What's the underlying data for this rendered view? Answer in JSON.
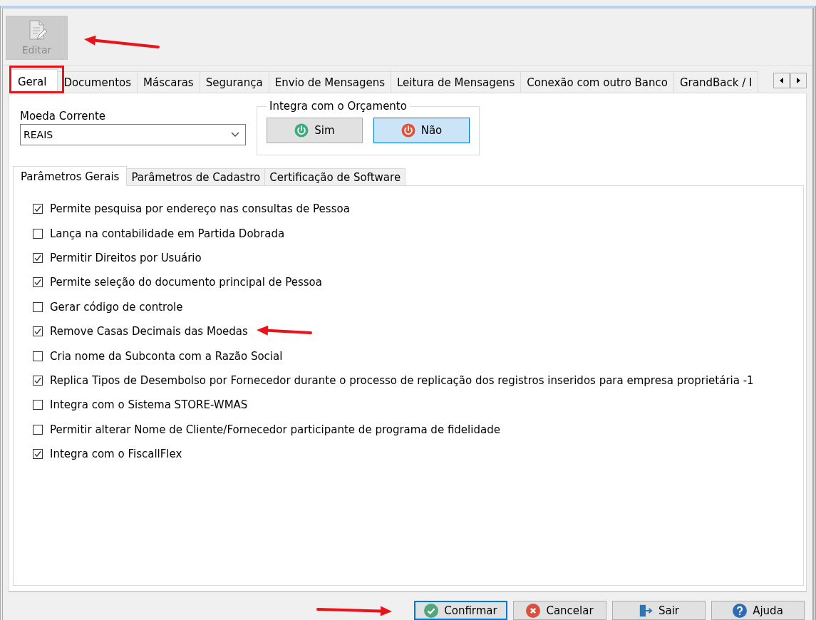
{
  "toolbar": {
    "buttons": [
      {
        "label": "Editar",
        "disabled": true
      }
    ]
  },
  "tabs": [
    {
      "label": "Geral",
      "selected": true
    },
    {
      "label": "Documentos",
      "selected": false
    },
    {
      "label": "Máscaras",
      "selected": false
    },
    {
      "label": "Segurança",
      "selected": false
    },
    {
      "label": "Envio de Mensagens",
      "selected": false
    },
    {
      "label": "Leitura de Mensagens",
      "selected": false
    },
    {
      "label": "Conexão com outro Banco",
      "selected": false
    },
    {
      "label": "GrandBack / I",
      "selected": false
    }
  ],
  "moeda_corrente": {
    "label": "Moeda Corrente",
    "value": "REAIS"
  },
  "integra_orcamento": {
    "title": "Integra com o Orçamento",
    "options": [
      {
        "label": "Sim",
        "color": "#3dab7a",
        "selected": false
      },
      {
        "label": "Não",
        "color": "#e0533a",
        "selected": true
      }
    ]
  },
  "sub_tabs": [
    {
      "label": "Parâmetros Gerais",
      "selected": true
    },
    {
      "label": "Parâmetros de Cadastro",
      "selected": false
    },
    {
      "label": "Certificação de Software",
      "selected": false
    }
  ],
  "parameters": [
    {
      "label": "Permite pesquisa por endereço nas consultas de Pessoa",
      "checked": true
    },
    {
      "label": "Lança na contabilidade em Partida Dobrada",
      "checked": false
    },
    {
      "label": "Permitir Direitos por Usuário",
      "checked": true
    },
    {
      "label": "Permite seleção do documento principal de Pessoa",
      "checked": true
    },
    {
      "label": "Gerar código de controle",
      "checked": false
    },
    {
      "label": "Remove Casas Decimais das Moedas",
      "checked": true
    },
    {
      "label": "Cria nome da Subconta com a Razão Social",
      "checked": false
    },
    {
      "label": "Replica Tipos de Desembolso por Fornecedor durante o processo de replicação dos registros inseridos para empresa proprietária -1",
      "checked": true
    },
    {
      "label": "Integra com o Sistema STORE-WMAS",
      "checked": false
    },
    {
      "label": "Permitir alterar Nome de Cliente/Fornecedor participante de programa de fidelidade",
      "checked": false
    },
    {
      "label": "Integra com o FiscallFlex",
      "checked": true
    }
  ],
  "footer_buttons": [
    {
      "kind": "confirm",
      "label": "Confirmar",
      "focused": true
    },
    {
      "kind": "cancel",
      "label": "Cancelar",
      "focused": false
    },
    {
      "kind": "exit",
      "label": "Sair",
      "focused": false
    },
    {
      "kind": "help",
      "label": "Ajuda",
      "focused": false
    }
  ]
}
